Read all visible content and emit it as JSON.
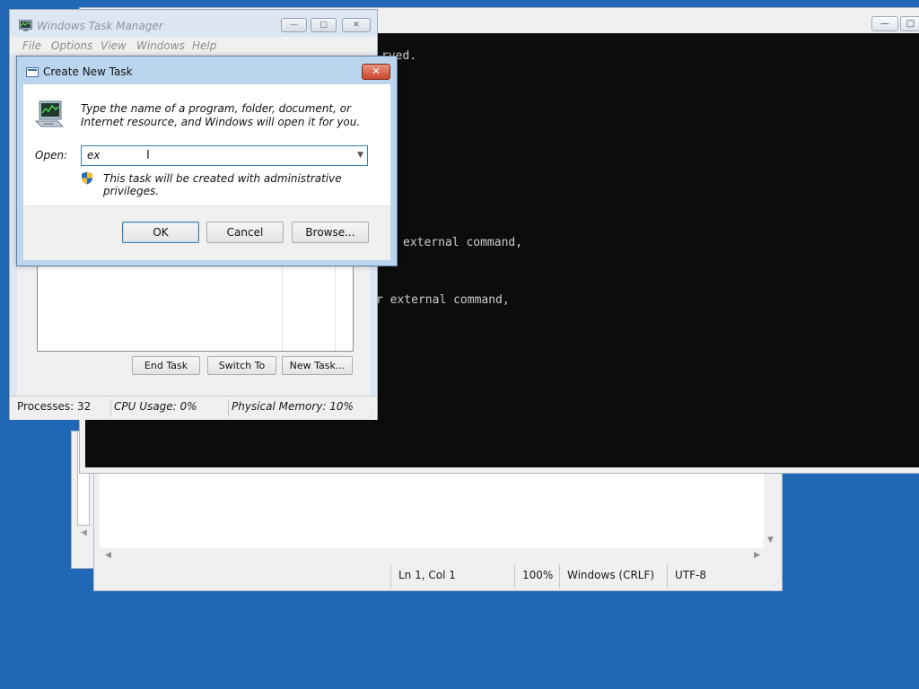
{
  "console": {
    "lines": [
      "rved.",
      "external command,",
      "r external command,"
    ]
  },
  "notepad": {
    "status": {
      "position": "Ln 1, Col 1",
      "zoom": "100%",
      "line_ending": "Windows (CRLF)",
      "encoding": "UTF-8"
    }
  },
  "task_manager": {
    "title": "Windows Task Manager",
    "menu": [
      "File",
      "Options",
      "View",
      "Windows",
      "Help"
    ],
    "buttons": {
      "end_task": "End Task",
      "switch_to": "Switch To",
      "new_task": "New Task..."
    },
    "status": {
      "processes": "Processes: 32",
      "cpu": "CPU Usage: 0%",
      "memory": "Physical Memory: 10%"
    }
  },
  "dialog": {
    "title": "Create New Task",
    "close_glyph": "✕",
    "description": "Type the name of a program, folder, document, or Internet resource, and Windows will open it for you.",
    "open_label": "Open:",
    "open_value": "ex",
    "admin_note": "This task will be created with administrative privileges.",
    "buttons": {
      "ok": "OK",
      "cancel": "Cancel",
      "browse": "Browse..."
    }
  },
  "icons": {
    "minimize": "minimize-icon",
    "maximize": "maximize-icon",
    "close": "close-icon",
    "shield": "uac-shield-icon",
    "program": "task-manager-program-icon"
  },
  "colors": {
    "desktop": "#2067b5",
    "console_bg": "#0c0c0c",
    "console_text": "#cccccc",
    "close_button": "#c8452f",
    "default_button_border": "#3c7fb1"
  }
}
